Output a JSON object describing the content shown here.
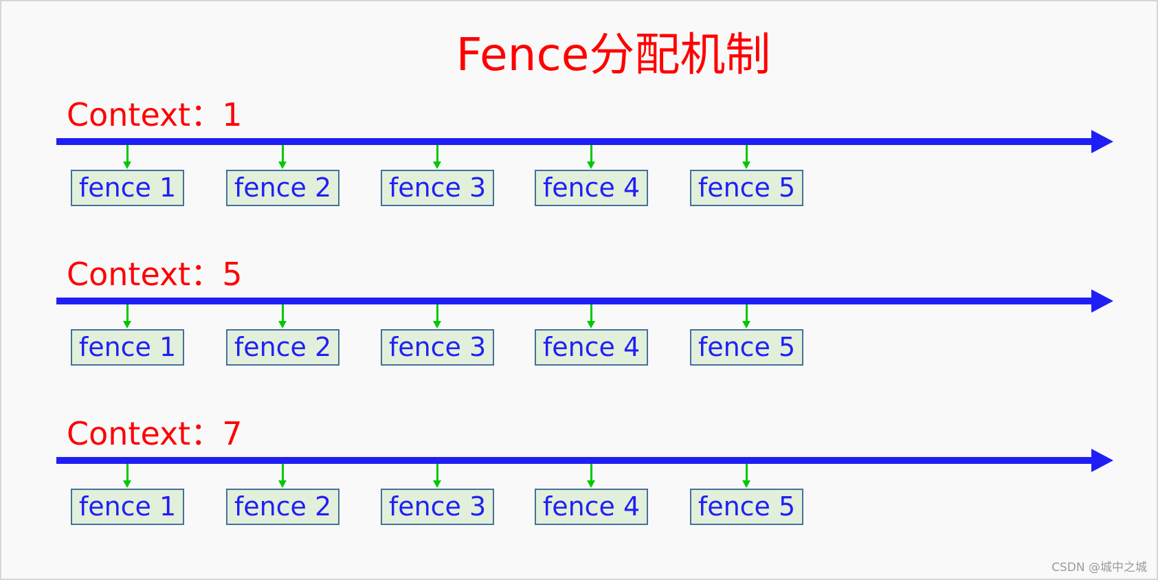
{
  "title": "Fence分配机制",
  "contexts": [
    {
      "label": "Context：1",
      "fences": [
        "fence 1",
        "fence 2",
        "fence 3",
        "fence 4",
        "fence 5"
      ]
    },
    {
      "label": "Context：5",
      "fences": [
        "fence 1",
        "fence 2",
        "fence 3",
        "fence 4",
        "fence 5"
      ]
    },
    {
      "label": "Context：7",
      "fences": [
        "fence 1",
        "fence 2",
        "fence 3",
        "fence 4",
        "fence 5"
      ]
    }
  ],
  "watermark": "CSDN @城中之城",
  "colors": {
    "title": "#ff0000",
    "timeline": "#1f1ff5",
    "fence_arrow": "#00c800",
    "fence_box_fill": "#e2efdb",
    "fence_box_border": "#41719c",
    "fence_text": "#1f1ff5"
  }
}
